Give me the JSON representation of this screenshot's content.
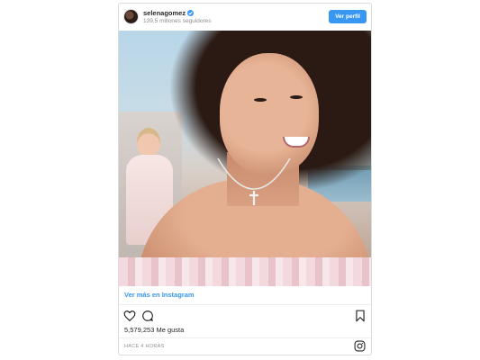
{
  "post": {
    "username": "selenagomez",
    "followers": "139,5 millones seguidores",
    "follow_button": "Ver perfil",
    "view_more": "Ver más en Instagram",
    "likes": "5,579,253 Me gusta",
    "timestamp": "HACE 4 HORAS"
  },
  "colors": {
    "accent": "#3897f0",
    "muted": "#8e8e8e",
    "border": "#dbdbdb"
  },
  "icons": {
    "like": "heart-icon",
    "comment": "comment-icon",
    "save": "bookmark-icon",
    "brand": "instagram-icon",
    "verified": "verified-badge-icon"
  }
}
